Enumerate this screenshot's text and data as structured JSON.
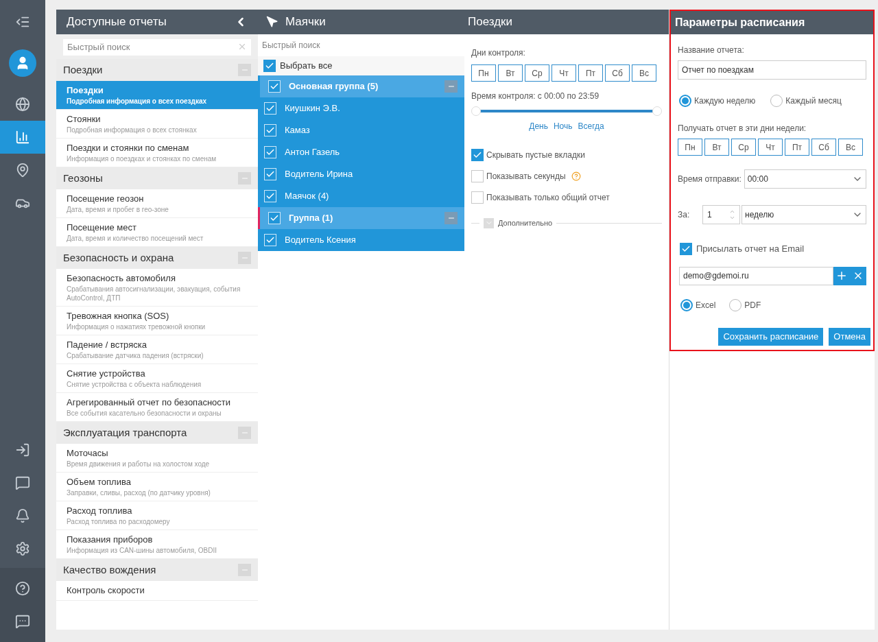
{
  "rail": {
    "top": [
      {
        "selected": false
      },
      {
        "selected": false
      },
      {
        "selected": false
      },
      {
        "selected": true
      },
      {
        "selected": false
      },
      {
        "selected": false
      }
    ],
    "bottom": [
      {
        "selected": false
      },
      {
        "selected": false
      },
      {
        "selected": false
      },
      {
        "selected": false
      }
    ],
    "footer": [
      {
        "selected": false
      },
      {
        "selected": false
      }
    ]
  },
  "reports": {
    "title": "Доступные отчеты",
    "search": {
      "placeholder": "Быстрый поиск"
    },
    "sections": [
      {
        "title": "Поездки",
        "items": [
          {
            "title": "Поездки",
            "subtitle": "Подробная информация о всех поездках",
            "selected": true
          },
          {
            "title": "Стоянки",
            "subtitle": "Подробная информация о всех стоянках",
            "selected": false
          },
          {
            "title": "Поездки и стоянки по сменам",
            "subtitle": "Информация о поездках и стоянках по сменам",
            "selected": false
          }
        ]
      },
      {
        "title": "Геозоны",
        "items": [
          {
            "title": "Посещение геозон",
            "subtitle": "Дата, время и пробег в гео-зоне",
            "selected": false
          },
          {
            "title": "Посещение мест",
            "subtitle": "Дата, время и количество посещений мест",
            "selected": false
          }
        ]
      },
      {
        "title": "Безопасность и охрана",
        "items": [
          {
            "title": "Безопасность автомобиля",
            "subtitle": "Срабатывания автосигнализации, эвакуация, события AutoControl, ДТП",
            "selected": false
          },
          {
            "title": "Тревожная кнопка (SOS)",
            "subtitle": "Информация о нажатиях тревожной кнопки",
            "selected": false
          },
          {
            "title": "Падение / встряска",
            "subtitle": "Срабатывание датчика падения (встряски)",
            "selected": false
          },
          {
            "title": "Снятие устройства",
            "subtitle": "Снятие устройства с объекта наблюдения",
            "selected": false
          },
          {
            "title": "Агрегированный отчет по безопасности",
            "subtitle": "Все события касательно безопасности и охраны",
            "selected": false
          }
        ]
      },
      {
        "title": "Эксплуатация транспорта",
        "items": [
          {
            "title": "Моточасы",
            "subtitle": "Время движения и работы на холостом ходе",
            "selected": false
          },
          {
            "title": "Объем топлива",
            "subtitle": "Заправки, сливы, расход (по датчику уровня)",
            "selected": false
          },
          {
            "title": "Расход топлива",
            "subtitle": "Расход топлива по расходомеру",
            "selected": false
          },
          {
            "title": "Показания приборов",
            "subtitle": "Информация из CAN-шины автомобиля, OBDII",
            "selected": false
          }
        ]
      },
      {
        "title": "Качество вождения",
        "items": [
          {
            "title": "Контроль скорости",
            "selected": false
          }
        ]
      }
    ]
  },
  "beacons": {
    "title": "Маячки",
    "search": {
      "placeholder": "Быстрый поиск"
    },
    "select_all": {
      "label": "Выбрать все",
      "checked": true
    },
    "groups": [
      {
        "name": "Основная группа (5)",
        "color": "#2196d9",
        "checked": true,
        "children": [
          {
            "name": "Киушкин Э.В.",
            "checked": true
          },
          {
            "name": "Камаз",
            "checked": true
          },
          {
            "name": "Антон Газель",
            "checked": true
          },
          {
            "name": "Водитель Ирина",
            "checked": true
          },
          {
            "name": "Маячок (4)",
            "checked": true
          }
        ]
      },
      {
        "name": "Группа (1)",
        "color": "#e0245e",
        "checked": true,
        "children": [
          {
            "name": "Водитель Ксения",
            "checked": true
          }
        ]
      }
    ]
  },
  "trips": {
    "title": "Поездки",
    "days_label": "Дни контроля:",
    "days": [
      {
        "label": "Пн",
        "selected": false
      },
      {
        "label": "Вт",
        "selected": false
      },
      {
        "label": "Ср",
        "selected": false
      },
      {
        "label": "Чт",
        "selected": false
      },
      {
        "label": "Пт",
        "selected": false
      },
      {
        "label": "Сб",
        "selected": false
      },
      {
        "label": "Вс",
        "selected": false
      }
    ],
    "time_label": "Время контроля: с 00:00 по 23:59",
    "time_slider": {
      "level": 1
    },
    "presets": [
      "День",
      "Ночь",
      "Всегда"
    ],
    "options": [
      {
        "label": "Скрывать пустые вкладки",
        "checked": true,
        "help": false
      },
      {
        "label": "Показывать секунды",
        "checked": false,
        "help": true
      },
      {
        "label": "Показывать только общий отчет",
        "checked": false,
        "help": false
      }
    ],
    "more": {
      "label": "Дополнительно",
      "expanded": false
    }
  },
  "schedule": {
    "title": "Параметры расписания",
    "name_label": "Название отчета:",
    "name_value": "Отчет по поездкам",
    "periods": [
      {
        "label": "Каждую неделю",
        "selected": true
      },
      {
        "label": "Каждый месяц",
        "selected": false
      }
    ],
    "days_label": "Получать отчет в эти дни недели:",
    "days": [
      {
        "label": "Пн",
        "selected": false
      },
      {
        "label": "Вт",
        "selected": false
      },
      {
        "label": "Ср",
        "selected": false
      },
      {
        "label": "Чт",
        "selected": false
      },
      {
        "label": "Пт",
        "selected": false
      },
      {
        "label": "Сб",
        "selected": false
      },
      {
        "label": "Вс",
        "selected": false
      }
    ],
    "send_time_label": "Время отправки:",
    "send_time": "00:00",
    "for_label": "За:",
    "for_count": "1",
    "for_unit": "неделю",
    "email_toggle": {
      "label": "Присылать отчет на Email",
      "checked": true
    },
    "email": "demo@gdemoi.ru",
    "formats": [
      {
        "label": "Excel",
        "selected": true
      },
      {
        "label": "PDF",
        "selected": false
      }
    ],
    "buttons": [
      {
        "label": "Сохранить расписание"
      },
      {
        "label": "Отмена"
      }
    ]
  }
}
